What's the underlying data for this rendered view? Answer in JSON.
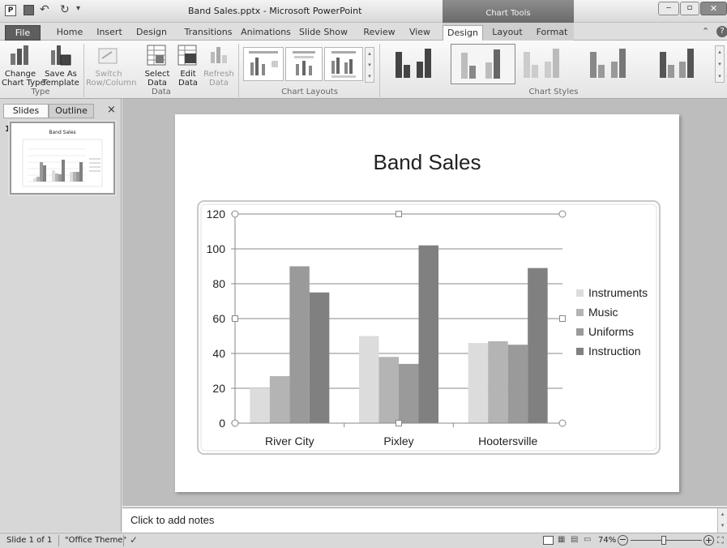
{
  "window": {
    "title": "Band Sales.pptx - Microsoft PowerPoint",
    "context_title": "Chart Tools"
  },
  "tabs": [
    "File",
    "Home",
    "Insert",
    "Design",
    "Transitions",
    "Animations",
    "Slide Show",
    "Review",
    "View",
    "Design",
    "Layout",
    "Format"
  ],
  "ribbon": {
    "type_group": {
      "label": "Type",
      "change_chart_type": "Change\nChart Type",
      "save_as_template": "Save As\nTemplate"
    },
    "data_group": {
      "label": "Data",
      "switch_row_column": "Switch\nRow/Column",
      "select_data": "Select\nData",
      "edit_data": "Edit\nData",
      "refresh_data": "Refresh\nData"
    },
    "chart_layouts_label": "Chart Layouts",
    "chart_styles_label": "Chart Styles"
  },
  "leftpane": {
    "tabs": [
      "Slides",
      "Outline"
    ],
    "close": "×",
    "slide_number": "1",
    "thumb_title": "Band Sales"
  },
  "slide": {
    "title": "Band Sales"
  },
  "chart_data": {
    "type": "bar",
    "title": "",
    "categories": [
      "River City",
      "Pixley",
      "Hootersville"
    ],
    "series": [
      {
        "name": "Instruments",
        "values": [
          20,
          50,
          46
        ],
        "color": "#dcdcdc"
      },
      {
        "name": "Music",
        "values": [
          27,
          38,
          47
        ],
        "color": "#b4b4b4"
      },
      {
        "name": "Uniforms",
        "values": [
          90,
          34,
          45
        ],
        "color": "#9a9a9a"
      },
      {
        "name": "Instruction",
        "values": [
          75,
          102,
          89
        ],
        "color": "#808080"
      }
    ],
    "y_ticks": [
      "0",
      "20",
      "40",
      "60",
      "80",
      "100",
      "120"
    ],
    "ylim": [
      0,
      120
    ],
    "grid": true,
    "legend": "right"
  },
  "notes": {
    "placeholder": "Click to add notes"
  },
  "status": {
    "slide": "Slide 1 of 1",
    "theme": "\"Office Theme\"",
    "zoom": "74%"
  }
}
